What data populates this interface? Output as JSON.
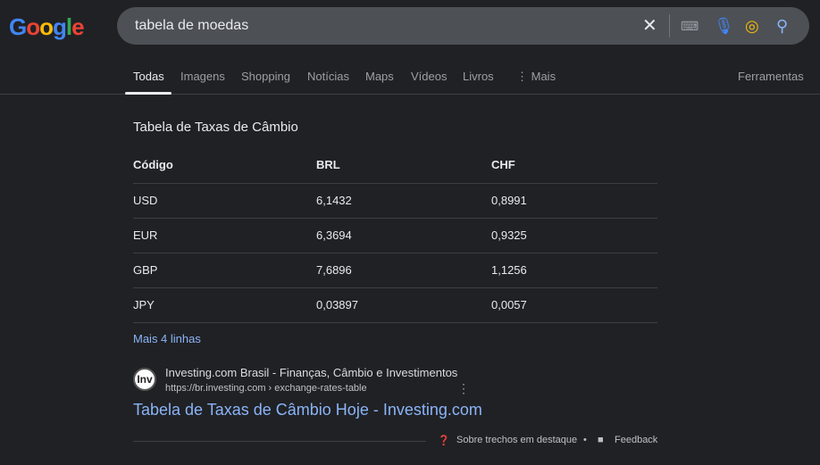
{
  "logo": "Google",
  "search": {
    "query": "tabela de moedas"
  },
  "tabs": [
    "Todas",
    "Imagens",
    "Shopping",
    "Notícias",
    "Maps",
    "Vídeos",
    "Livros",
    "Mais"
  ],
  "tools": "Ferramentas",
  "snippet": {
    "title": "Tabela de Taxas de Câmbio",
    "headers": [
      "Código",
      "BRL",
      "CHF"
    ],
    "rows": [
      [
        "USD",
        "6,1432",
        "0,8991"
      ],
      [
        "EUR",
        "6,3694",
        "0,9325"
      ],
      [
        "GBP",
        "7,6896",
        "1,1256"
      ],
      [
        "JPY",
        "0,03897",
        "0,0057"
      ]
    ],
    "more": "Mais 4 linhas"
  },
  "result": {
    "favicon": "Inv",
    "site": "Investing.com Brasil - Finanças, Câmbio e Investimentos",
    "url": "https://br.investing.com › exchange-rates-table",
    "title": "Tabela de Taxas de Câmbio Hoje - Investing.com"
  },
  "footer": {
    "about": "Sobre trechos em destaque",
    "feedback": "Feedback"
  }
}
